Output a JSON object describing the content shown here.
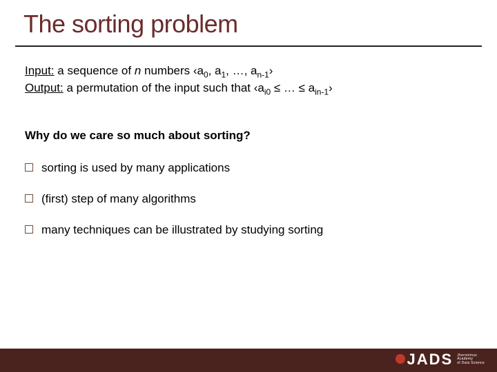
{
  "title": "The sorting problem",
  "input": {
    "label": "Input:",
    "text_pre": " a sequence of ",
    "n": "n",
    "text_post": " numbers ‹a",
    "s0": "0",
    "c1": ", a",
    "s1": "1",
    "c2": ", …, a",
    "snm1": "n-1",
    "close": "›"
  },
  "output": {
    "label": "Output:",
    "text_pre": " a permutation of the input such that ‹a",
    "si0": "i0",
    "mid": " ≤ … ≤ a",
    "sinm1": "in-1",
    "close": "›"
  },
  "question": "Why do we care so much about sorting?",
  "bullets": [
    {
      "text": "sorting is used by many applications"
    },
    {
      "text": "(first) step of many algorithms"
    },
    {
      "text": "many techniques can be illustrated by studying sorting"
    }
  ],
  "brand": {
    "main": "JADS",
    "sub_l1": "Jheronimus",
    "sub_l2": "Academy",
    "sub_l3": "of Data Science"
  }
}
